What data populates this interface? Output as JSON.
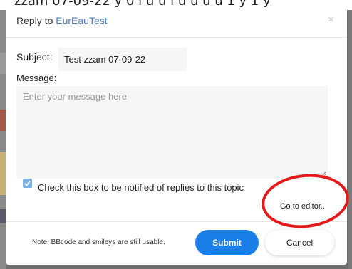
{
  "background": {
    "strip_text": "zzam 07-09-22 y 0 l u u l u u u u 1 y 1 y"
  },
  "modal": {
    "title_prefix": "Reply to ",
    "title_link": "EurEauTest",
    "close_symbol": "×"
  },
  "form": {
    "subject_label": "Subject:",
    "subject_value": "Test zzam 07-09-22",
    "message_label": "Message:",
    "message_placeholder": "Enter your message here",
    "notify_label": "Check this box to be notified of replies to this topic",
    "notify_checked": true,
    "go_to_editor": "Go to editor.."
  },
  "footer": {
    "note": "Note: BBcode and smileys are still usable.",
    "submit_label": "Submit",
    "cancel_label": "Cancel"
  },
  "colors": {
    "accent": "#1a7ee8",
    "link": "#4a7bc4",
    "annotation": "#e41a1a"
  }
}
